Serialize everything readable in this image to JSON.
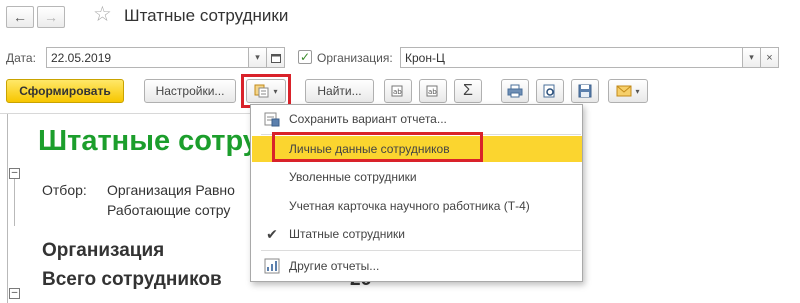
{
  "window": {
    "title": "Штатные сотрудники",
    "back_icon": "arrow-left-icon",
    "forward_icon": "arrow-right-icon",
    "favorite_icon": "star-icon"
  },
  "form": {
    "date_label": "Дата:",
    "date_value": "22.05.2019",
    "org_checked": true,
    "org_label": "Организация:",
    "org_value": "Крон-Ц"
  },
  "toolbar": {
    "generate_label": "Сформировать",
    "settings_label": "Настройки...",
    "find_label": "Найти...",
    "sum_glyph": "Σ"
  },
  "report": {
    "title": "Штатные сотру",
    "filter_label": "Отбор:",
    "filter_line1": "Организация Равно",
    "filter_line2": "Работающие сотру",
    "org_header": "Организация",
    "total_label": "Всего сотрудников",
    "total_value": "26"
  },
  "menu": {
    "items": [
      {
        "label": "Сохранить вариант отчета...",
        "icon": "save-variant-icon"
      },
      {
        "label": "Личные данные сотрудников",
        "icon": "",
        "highlighted": true
      },
      {
        "label": "Уволенные сотрудники",
        "icon": ""
      },
      {
        "label": "Учетная карточка научного работника (Т-4)",
        "icon": ""
      },
      {
        "label": "Штатные сотрудники",
        "icon": "check-icon",
        "checked": true
      },
      {
        "label": "Другие отчеты...",
        "icon": "other-reports-icon"
      }
    ]
  },
  "colors": {
    "accent_yellow": "#f7c600",
    "highlight_yellow": "#fbd52f",
    "annotation_red": "#d9222a",
    "report_title_green": "#1c9e2c"
  }
}
